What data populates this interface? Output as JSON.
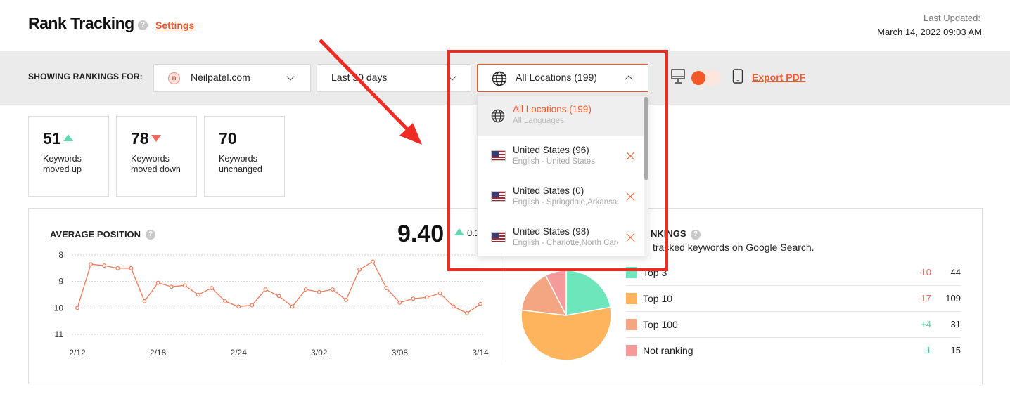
{
  "header": {
    "title": "Rank Tracking",
    "settings_link": "Settings",
    "last_updated_label": "Last Updated:",
    "last_updated_value": "March 14, 2022 09:03 AM"
  },
  "filters": {
    "showing_label": "SHOWING RANKINGS FOR:",
    "site": {
      "logo_letter": "n",
      "value": "Neilpatel.com"
    },
    "date_range": "Last 30 days",
    "location": "All Locations (199)",
    "export_label": "Export PDF"
  },
  "location_dropdown": {
    "items": [
      {
        "name": "All Locations (199)",
        "sub": "All Languages",
        "selected": true,
        "icon": "globe-icon"
      },
      {
        "name": "United States (96)",
        "sub": "English - United States",
        "icon": "us-flag-icon"
      },
      {
        "name": "United States (0)",
        "sub": "English - Springdale,Arkansas",
        "icon": "us-flag-icon"
      },
      {
        "name": "United States (98)",
        "sub": "English - Charlotte,North Carolina",
        "icon": "us-flag-icon"
      }
    ]
  },
  "stats": [
    {
      "value": "51",
      "desc_1": "Keywords",
      "desc_2": "moved up",
      "trend": "up"
    },
    {
      "value": "78",
      "desc_1": "Keywords",
      "desc_2": "moved down",
      "trend": "down"
    },
    {
      "value": "70",
      "desc_1": "Keywords",
      "desc_2": "unchanged",
      "trend": "none"
    }
  ],
  "average_position": {
    "title": "AVERAGE POSITION",
    "value": "9.40",
    "change": "0.1"
  },
  "rankings": {
    "title": "NKINGS",
    "subtitle": "tracked keywords on Google Search.",
    "rows": [
      {
        "label": "Top 3",
        "change": "-10",
        "count": "44",
        "color": "#6ee6bc",
        "change_color": "#ee6a5e"
      },
      {
        "label": "Top 10",
        "change": "-17",
        "count": "109",
        "color": "#fdb45c",
        "change_color": "#ee6a5e"
      },
      {
        "label": "Top 100",
        "change": "+4",
        "count": "31",
        "color": "#f4a582",
        "change_color": "#4fcf9f"
      },
      {
        "label": "Not ranking",
        "change": "-1",
        "count": "15",
        "color": "#f49a9a",
        "change_color": "#4fcf9f"
      }
    ]
  },
  "colors": {
    "accent": "#f2592a",
    "annotation": "#ef2b24",
    "line": "#f07a5a"
  },
  "chart_data": [
    {
      "type": "line",
      "title": "AVERAGE POSITION",
      "x_tick_labels": [
        "2/12",
        "2/18",
        "2/24",
        "3/02",
        "3/08",
        "3/14"
      ],
      "y_tick_labels": [
        "8",
        "9",
        "10",
        "11"
      ],
      "ylim": [
        8,
        11
      ],
      "y_inverted": true,
      "grid": true,
      "series": [
        {
          "values": [
            10.0,
            8.35,
            8.4,
            8.5,
            8.5,
            9.75,
            9.05,
            9.2,
            9.15,
            9.5,
            9.25,
            9.75,
            9.95,
            9.9,
            9.3,
            9.55,
            9.95,
            9.3,
            9.4,
            9.3,
            9.7,
            8.55,
            8.25,
            9.25,
            9.8,
            9.65,
            9.6,
            9.45,
            9.95,
            10.2,
            9.85
          ]
        }
      ]
    },
    {
      "type": "pie",
      "categories": [
        "Top 3",
        "Top 10",
        "Top 100",
        "Not ranking"
      ],
      "values": [
        44,
        109,
        31,
        15
      ]
    }
  ]
}
